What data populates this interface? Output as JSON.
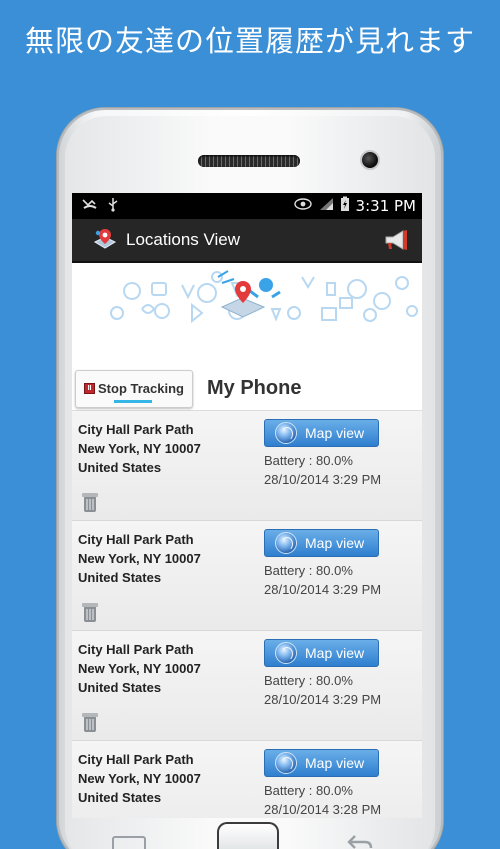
{
  "headline": "無限の友達の位置履歴が見れます",
  "statusbar": {
    "time": "3:31 PM"
  },
  "actionbar": {
    "title": "Locations View"
  },
  "tracking": {
    "stop_label": "Stop Tracking",
    "device_name": "My Phone",
    "stop_icon_text": "II"
  },
  "locations": [
    {
      "street": "City Hall Park Path",
      "city": "New York, NY 10007",
      "country": "United States",
      "map_label": "Map view",
      "battery": "Battery : 80.0%",
      "datetime": "28/10/2014 3:29 PM"
    },
    {
      "street": "City Hall Park Path",
      "city": "New York, NY 10007",
      "country": "United States",
      "map_label": "Map view",
      "battery": "Battery : 80.0%",
      "datetime": "28/10/2014 3:29 PM"
    },
    {
      "street": "City Hall Park Path",
      "city": "New York, NY 10007",
      "country": "United States",
      "map_label": "Map view",
      "battery": "Battery : 80.0%",
      "datetime": "28/10/2014 3:29 PM"
    },
    {
      "street": "City Hall Park Path",
      "city": "New York, NY 10007",
      "country": "United States",
      "map_label": "Map view",
      "battery": "Battery : 80.0%",
      "datetime": "28/10/2014 3:28 PM"
    }
  ],
  "colors": {
    "background": "#3a8fd6",
    "map_button": "#2f7fcf",
    "stop_icon": "#c0272d",
    "tab_indicator": "#33b5e5"
  },
  "icons": {
    "missed-call": "missed-call-icon",
    "usb": "usb-icon",
    "eye": "eye-icon",
    "signal": "signal-icon",
    "battery": "battery-charging-icon",
    "app": "app-logo-icon",
    "megaphone": "megaphone-icon",
    "globe": "globe-icon",
    "trash": "trash-icon"
  }
}
